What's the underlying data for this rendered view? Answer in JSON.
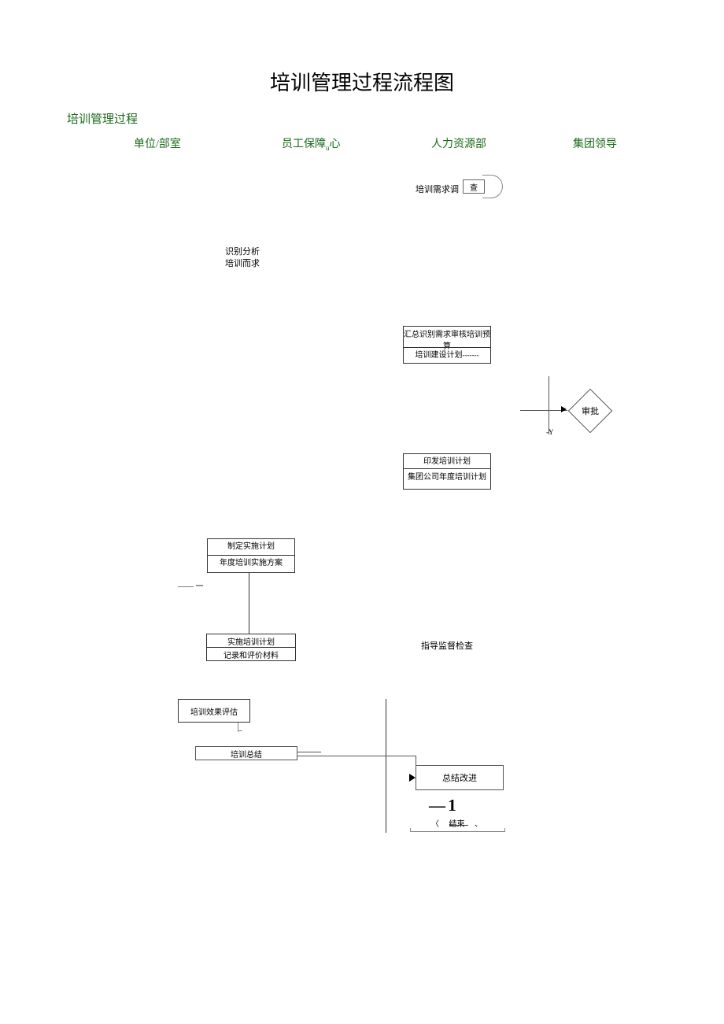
{
  "title": "培训管理过程流程图",
  "section_label": "培训管理过程",
  "columns": {
    "c1": "单位/部室",
    "c2_a": "员工保障",
    "c2_b": "心",
    "c2_sub": "u",
    "c3": "人力资源部",
    "c4": "集团领导"
  },
  "nodes": {
    "survey_label": "培训需求调",
    "survey_box": "查",
    "identify_1": "识别分析",
    "identify_2": "培训而求",
    "summarize_top": "汇总识别需求审核培训预算",
    "summarize_bottom_a": "培训建设计划",
    "summarize_dashes": "-------",
    "decision": "审批",
    "decision_y": "-Y",
    "issue_top": "印发培训计划",
    "issue_bottom": "集团公司年度培训计划",
    "impl_top": "制定实施计划",
    "impl_bottom": "年度培训实施方案",
    "dash_mark": "—— 一",
    "exec_top": "实施培训计划",
    "exec_bottom": "记录和评价材料",
    "guidance": "指导监督检查",
    "evaluation": "培训效果评估",
    "training_summary": "培训总结",
    "improve": "总结改进",
    "minus1": "— 1",
    "end_paren_l": "〈",
    "end_text": "结束",
    "end_paren_r": "、"
  }
}
